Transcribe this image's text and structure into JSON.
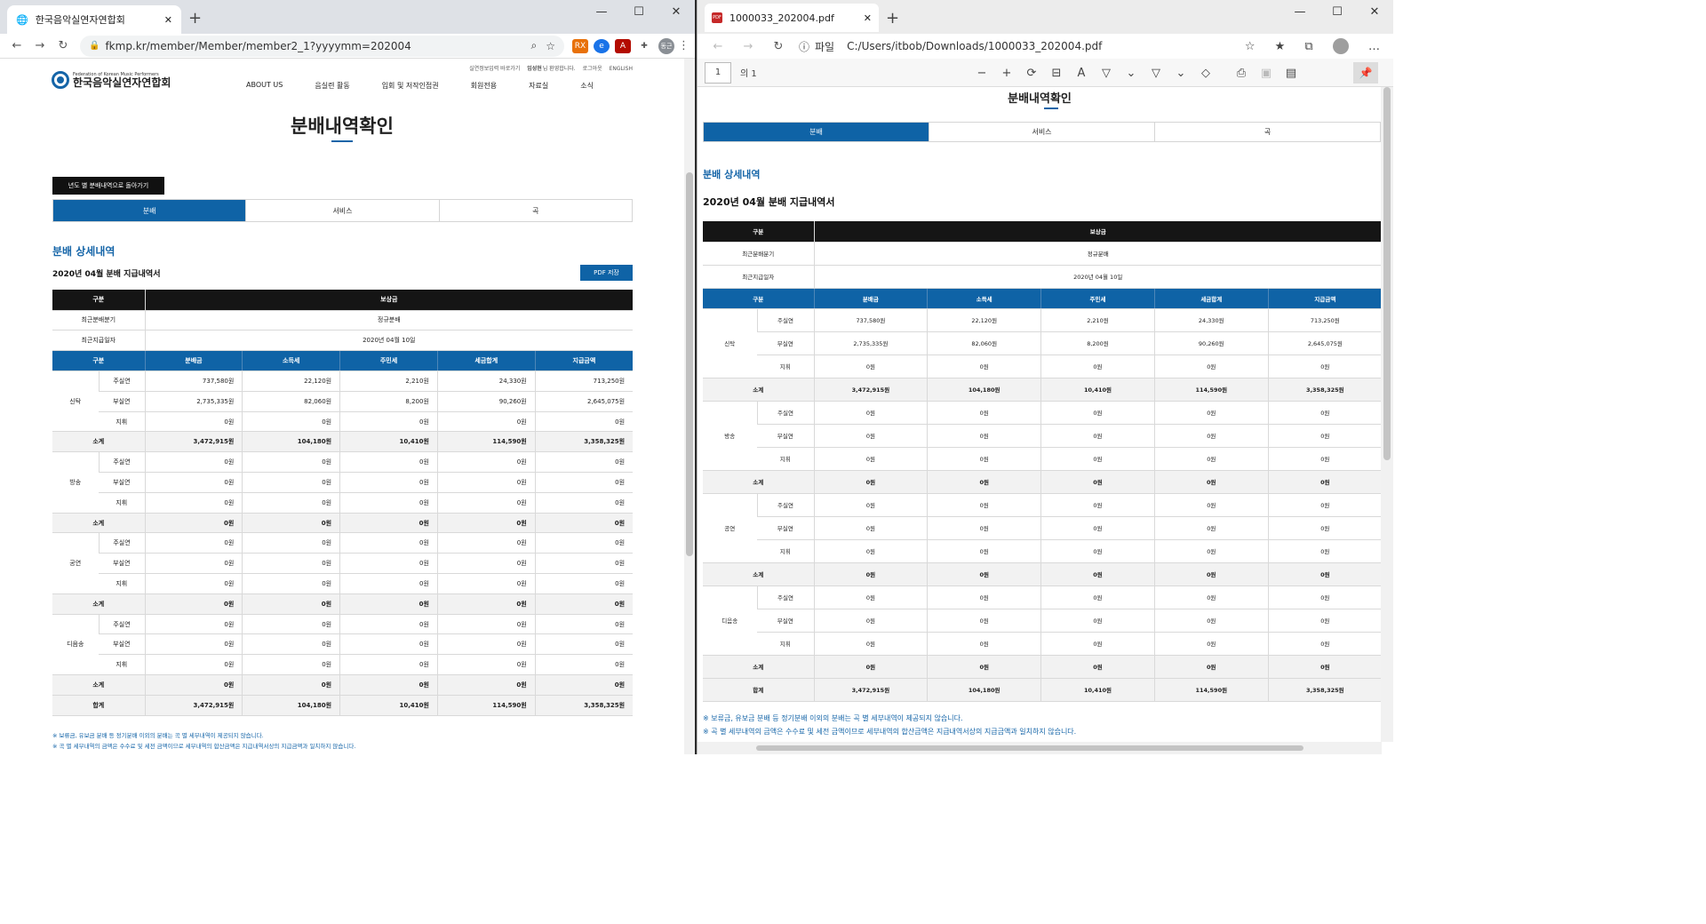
{
  "chrome": {
    "tab_title": "한국음악실연자연합회",
    "url": "fkmp.kr/member/Member/member2_1?yyyymm=202004",
    "ext_rx": "RX",
    "avatar": "동근",
    "site": {
      "util_links": [
        "실연정보입력 바로가기",
        "임성현",
        "님 환영합니다.",
        "로그아웃",
        "ENGLISH"
      ],
      "logo_en": "Federation of Korean Music Performers",
      "logo_ko": "한국음악실연자연합회",
      "nav": [
        "ABOUT US",
        "음실련 활동",
        "입회 및 저작인접권",
        "회원전용",
        "자료실",
        "소식"
      ],
      "page_title": "분배내역확인",
      "back_button": "년도 별 분배내역으로 돌아가기",
      "pdf_button": "PDF 저장"
    }
  },
  "edge": {
    "tab_title": "1000033_202004.pdf",
    "file_label": "파일",
    "url": "C:/Users/itbob/Downloads/1000033_202004.pdf",
    "page_number": "1",
    "page_of": "의 1",
    "doc_title": "분배내역확인"
  },
  "report": {
    "tabs": [
      "분배",
      "서비스",
      "곡"
    ],
    "active_tab": 0,
    "section_title": "분배 상세내역",
    "statement_title": "2020년 04월 분배 지급내역서",
    "summary_header": [
      "구분",
      "보상금"
    ],
    "summary_rows": [
      {
        "label": "최근분배분기",
        "value": "정규분배"
      },
      {
        "label": "최근지급일자",
        "value": "2020년 04월 10일"
      }
    ],
    "columns": [
      "구분",
      "분배금",
      "소득세",
      "주민세",
      "세금합계",
      "지급금액"
    ],
    "groups": [
      {
        "name": "신탁",
        "rows": [
          {
            "label": "주실연",
            "values": [
              "737,580원",
              "22,120원",
              "2,210원",
              "24,330원",
              "713,250원"
            ]
          },
          {
            "label": "부실연",
            "values": [
              "2,735,335원",
              "82,060원",
              "8,200원",
              "90,260원",
              "2,645,075원"
            ]
          },
          {
            "label": "지휘",
            "values": [
              "0원",
              "0원",
              "0원",
              "0원",
              "0원"
            ]
          }
        ],
        "subtotal": [
          "3,472,915원",
          "104,180원",
          "10,410원",
          "114,590원",
          "3,358,325원"
        ]
      },
      {
        "name": "방송",
        "rows": [
          {
            "label": "주실연",
            "values": [
              "0원",
              "0원",
              "0원",
              "0원",
              "0원"
            ]
          },
          {
            "label": "부실연",
            "values": [
              "0원",
              "0원",
              "0원",
              "0원",
              "0원"
            ]
          },
          {
            "label": "지휘",
            "values": [
              "0원",
              "0원",
              "0원",
              "0원",
              "0원"
            ]
          }
        ],
        "subtotal": [
          "0원",
          "0원",
          "0원",
          "0원",
          "0원"
        ]
      },
      {
        "name": "공연",
        "rows": [
          {
            "label": "주실연",
            "values": [
              "0원",
              "0원",
              "0원",
              "0원",
              "0원"
            ]
          },
          {
            "label": "부실연",
            "values": [
              "0원",
              "0원",
              "0원",
              "0원",
              "0원"
            ]
          },
          {
            "label": "지휘",
            "values": [
              "0원",
              "0원",
              "0원",
              "0원",
              "0원"
            ]
          }
        ],
        "subtotal": [
          "0원",
          "0원",
          "0원",
          "0원",
          "0원"
        ]
      },
      {
        "name": "디음송",
        "rows": [
          {
            "label": "주실연",
            "values": [
              "0원",
              "0원",
              "0원",
              "0원",
              "0원"
            ]
          },
          {
            "label": "부실연",
            "values": [
              "0원",
              "0원",
              "0원",
              "0원",
              "0원"
            ]
          },
          {
            "label": "지휘",
            "values": [
              "0원",
              "0원",
              "0원",
              "0원",
              "0원"
            ]
          }
        ],
        "subtotal": [
          "0원",
          "0원",
          "0원",
          "0원",
          "0원"
        ]
      }
    ],
    "subtotal_label": "소계",
    "total_label": "합계",
    "total": [
      "3,472,915원",
      "104,180원",
      "10,410원",
      "114,590원",
      "3,358,325원"
    ],
    "notes": [
      "※ 보류금, 유보금 분배 등 정기분배 이외의 분배는 곡 별 세부내역이 제공되지 않습니다.",
      "※ 곡 별 세부내역의 금액은 수수료 및 세전 금액이므로 세부내역의 합산금액은 지급내역서상의 지급금액과 일치하지 않습니다."
    ]
  },
  "colors": {
    "accent": "#0f63a6",
    "header_dark": "#151515"
  }
}
